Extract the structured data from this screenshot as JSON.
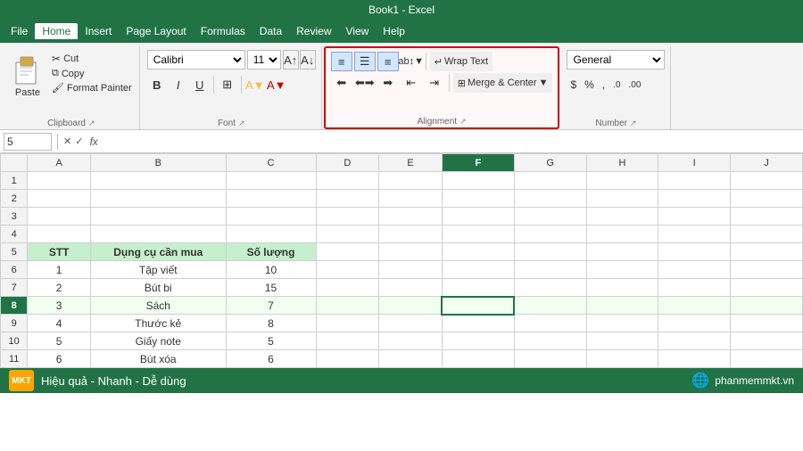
{
  "titlebar": {
    "text": "Book1 - Excel"
  },
  "menubar": {
    "items": [
      "File",
      "Home",
      "Insert",
      "Page Layout",
      "Formulas",
      "Data",
      "Review",
      "View",
      "Help"
    ],
    "active": "Home"
  },
  "ribbon": {
    "clipboard": {
      "label": "Clipboard",
      "paste": "Paste",
      "cut": "Cut",
      "copy": "Copy",
      "format_painter": "Format Painter"
    },
    "font": {
      "label": "Font",
      "font_name": "Calibri",
      "font_size": "11",
      "increase_size": "A",
      "decrease_size": "A",
      "bold": "B",
      "italic": "I",
      "underline": "U",
      "border": "⊞",
      "fill": "A",
      "color": "A"
    },
    "alignment": {
      "label": "Alignment",
      "wrap_text": "Wrap Text",
      "merge_center": "Merge & Center",
      "highlighted": true
    },
    "number": {
      "label": "Number",
      "format": "General",
      "dollar": "$",
      "percent": "%",
      "comma": ",",
      "increase_decimal": ".0",
      "decrease_decimal": ".00"
    }
  },
  "formulabar": {
    "cell_ref": "5",
    "fx": "fx",
    "value": ""
  },
  "columns": [
    "",
    "A",
    "B",
    "C",
    "D",
    "E",
    "F",
    "G",
    "H",
    "I",
    "J"
  ],
  "rows": [
    {
      "num": "1",
      "cells": [
        "",
        "",
        "",
        "",
        "",
        "",
        "",
        "",
        "",
        ""
      ]
    },
    {
      "num": "2",
      "cells": [
        "",
        "",
        "",
        "",
        "",
        "",
        "",
        "",
        "",
        ""
      ]
    },
    {
      "num": "3",
      "cells": [
        "",
        "",
        "",
        "",
        "",
        "",
        "",
        "",
        "",
        ""
      ]
    },
    {
      "num": "4",
      "cells": [
        "",
        "",
        "",
        "",
        "",
        "",
        "",
        "",
        "",
        ""
      ]
    },
    {
      "num": "5",
      "cells": [
        "STT",
        "Dụng cụ cần mua",
        "Số lượng",
        "",
        "",
        "",
        "",
        "",
        "",
        ""
      ]
    },
    {
      "num": "6",
      "cells": [
        "1",
        "Tập viết",
        "10",
        "",
        "",
        "",
        "",
        "",
        "",
        ""
      ]
    },
    {
      "num": "7",
      "cells": [
        "2",
        "Bút bi",
        "15",
        "",
        "",
        "",
        "",
        "",
        "",
        ""
      ]
    },
    {
      "num": "8",
      "cells": [
        "3",
        "Sách",
        "7",
        "",
        "",
        "",
        "",
        "",
        "",
        ""
      ]
    },
    {
      "num": "9",
      "cells": [
        "4",
        "Thước kẻ",
        "8",
        "",
        "",
        "",
        "",
        "",
        "",
        ""
      ]
    },
    {
      "num": "10",
      "cells": [
        "5",
        "Giấy note",
        "5",
        "",
        "",
        "",
        "",
        "",
        "",
        ""
      ]
    },
    {
      "num": "11",
      "cells": [
        "6",
        "Bút xóa",
        "6",
        "",
        "",
        "",
        "",
        "",
        "",
        ""
      ]
    }
  ],
  "active_cell": {
    "row": 8,
    "col": 5
  },
  "statusbar": {
    "logo": "MKT",
    "text": "Hiệu quả - Nhanh - Dễ dùng",
    "website": "phanmemmkt.vn"
  }
}
